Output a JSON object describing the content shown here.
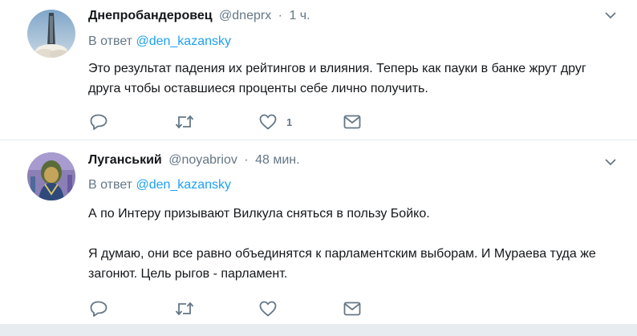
{
  "tweets": [
    {
      "name": "Днепробандеровец",
      "handle": "@dneprx",
      "separator": "·",
      "time": "1 ч.",
      "reply_prefix": "В ответ",
      "reply_to": "@den_kazansky",
      "paragraphs": [
        "Это результат падения их рейтингов и влияния. Теперь как пауки в банке жрут друг друга чтобы оставшиеся проценты себе лично получить."
      ],
      "like_count": "1",
      "avatar_icon": "rocket-launch-avatar"
    },
    {
      "name": "Луганський",
      "handle": "@noyabriov",
      "separator": "·",
      "time": "48 мин.",
      "reply_prefix": "В ответ",
      "reply_to": "@den_kazansky",
      "paragraphs": [
        "А по Интеру призывают Вилкула сняться в пользу Бойко.",
        "Я думаю, они все равно объединятся к парламентским выборам. И Мураева туда же загонют. Цель рыгов - парламент."
      ],
      "like_count": "",
      "avatar_icon": "portrait-painting-avatar"
    }
  ],
  "colors": {
    "text": "#14171a",
    "secondary": "#657786",
    "link": "#1da1f2",
    "divider": "#e6ecf0"
  },
  "icons": [
    "reply-icon",
    "retweet-icon",
    "like-icon",
    "direct-message-icon",
    "chevron-down-icon"
  ]
}
